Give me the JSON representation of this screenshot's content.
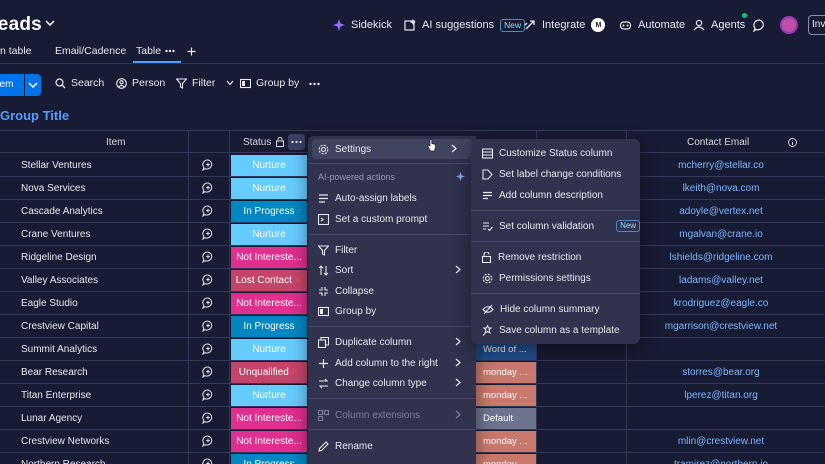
{
  "header": {
    "board_title": "Leads",
    "sidekick": "Sidekick",
    "ai_suggestions": "AI suggestions",
    "ai_new_badge": "New",
    "integrate": "Integrate",
    "integrate_badge": "M",
    "automate": "Automate",
    "agents": "Agents",
    "invite": "Inv"
  },
  "view_tabs": [
    "n table",
    "Email/Cadence",
    "Table"
  ],
  "toolbar": {
    "new_item": "Item",
    "search": "Search",
    "person": "Person",
    "filter": "Filter",
    "group_by": "Group by"
  },
  "group": {
    "title": "Group Title"
  },
  "columns": {
    "item": "Item",
    "status": "Status",
    "contact_email": "Contact Email"
  },
  "rows": [
    {
      "name": "Stellar Ventures",
      "status": "Nurture",
      "status_color": "#66ccff",
      "email": "mcherry@stellar.co"
    },
    {
      "name": "Nova Services",
      "status": "Nurture",
      "status_color": "#66ccff",
      "email": "lkeith@nova.com"
    },
    {
      "name": "Cascade Analytics",
      "status": "In Progress",
      "status_color": "#0086c0",
      "email": "adoyle@vertex.net"
    },
    {
      "name": "Crane Ventures",
      "status": "Nurture",
      "status_color": "#66ccff",
      "email": "mgalvan@crane.io"
    },
    {
      "name": "Ridgeline Design",
      "status": "Not Intereste...",
      "status_color": "#df2f8f",
      "email": "lshields@ridgeline.com"
    },
    {
      "name": "Valley Associates",
      "status": "Lost Contact",
      "status_color": "#c44569",
      "lost": "✕",
      "email": "ladams@valley.net"
    },
    {
      "name": "Eagle Studio",
      "status": "Not Intereste...",
      "status_color": "#df2f8f",
      "email": "krodriguez@eagle.co"
    },
    {
      "name": "Crestview Capital",
      "status": "In Progress",
      "status_color": "#0086c0",
      "email": "mgarrison@crestview.net"
    },
    {
      "name": "Summit Analytics",
      "status": "Nurture",
      "status_color": "#66ccff",
      "email": "",
      "mid": "Word of ...",
      "mid_color": "#225091"
    },
    {
      "name": "Bear Research",
      "status": "Unqualified",
      "status_color": "#c44569",
      "lost": "✕",
      "email": "storres@bear.org",
      "mid": "monday ...",
      "mid_color": "#c9796b"
    },
    {
      "name": "Titan Enterprise",
      "status": "Nurture",
      "status_color": "#66ccff",
      "email": "lperez@titan.org",
      "mid": "monday ...",
      "mid_color": "#c9796b"
    },
    {
      "name": "Lunar Agency",
      "status": "Not Intereste...",
      "status_color": "#df2f8f",
      "email": "",
      "mid": "Default",
      "mid_color": "#6e738e"
    },
    {
      "name": "Crestview Networks",
      "status": "Not Intereste...",
      "status_color": "#df2f8f",
      "email": "mlin@crestview.net",
      "mid": "monday ...",
      "mid_color": "#c9796b"
    },
    {
      "name": "Northern Research",
      "status": "In Progress",
      "status_color": "#0086c0",
      "email": "tramirez@northern.io",
      "mid": "monday ...",
      "mid_color": "#c9796b"
    }
  ],
  "column_menu": {
    "settings": "Settings",
    "ai_section": "AI-powered actions",
    "auto_assign": "Auto-assign labels",
    "custom_prompt": "Set a custom prompt",
    "filter": "Filter",
    "sort": "Sort",
    "collapse": "Collapse",
    "group_by": "Group by",
    "duplicate": "Duplicate column",
    "add_right": "Add column to the right",
    "change_type": "Change column type",
    "extensions": "Column extensions",
    "rename": "Rename"
  },
  "settings_submenu": {
    "customize": "Customize Status column",
    "label_conditions": "Set label change conditions",
    "description": "Add column description",
    "validation": "Set column validation",
    "validation_badge": "New",
    "remove_restriction": "Remove restriction",
    "permissions": "Permissions settings",
    "hide_summary": "Hide column summary",
    "save_template": "Save column as a template"
  },
  "colors": {
    "accent": "#579bfc",
    "primary_button": "#0073ea",
    "background": "#181b34",
    "menu": "#30324e"
  }
}
